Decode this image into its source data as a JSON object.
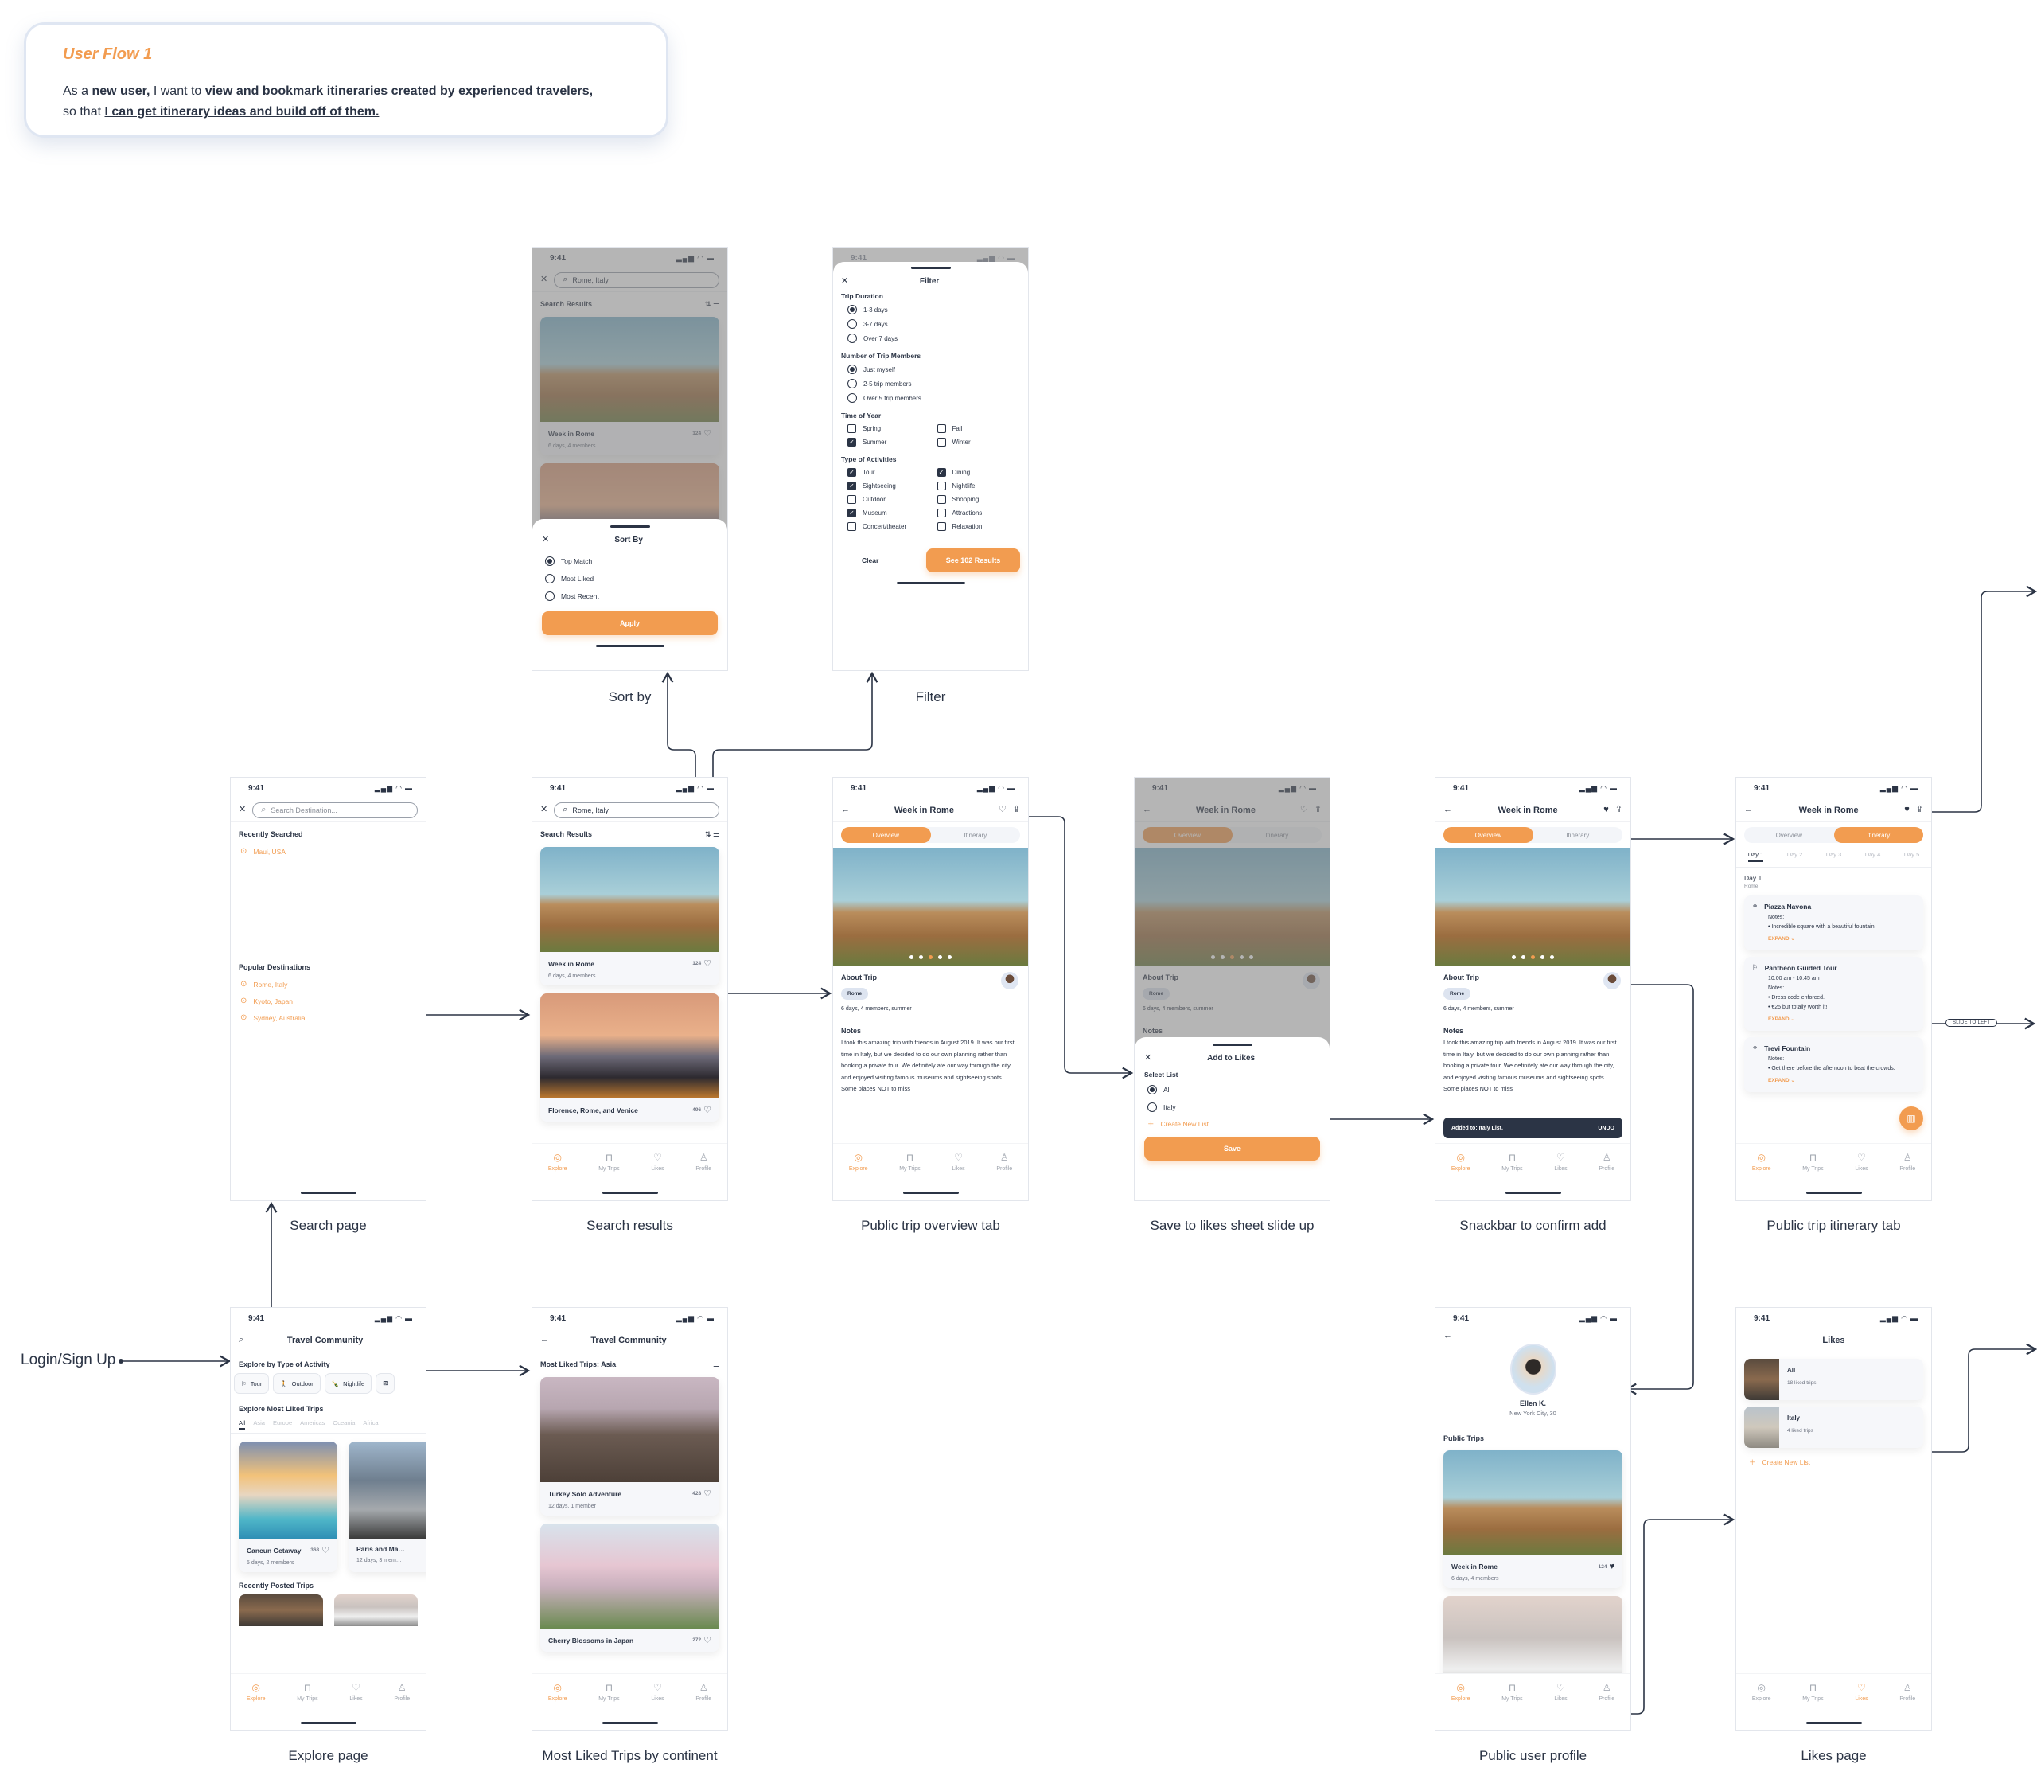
{
  "story": {
    "title": "User Flow 1",
    "prefix": "As a",
    "role": "new user,",
    "mid": "I want to",
    "goal": "view and bookmark itineraries created by experienced travelers,",
    "so": "so that",
    "benefit": "I can get itinerary ideas and build off of them."
  },
  "status_time": "9:41",
  "status_icons": "▂▄▆ ◠ ▬",
  "tabbar": [
    {
      "label": "Explore",
      "icon": "compass-icon",
      "glyph": "◎"
    },
    {
      "label": "My Trips",
      "icon": "bag-icon",
      "glyph": "⊓"
    },
    {
      "label": "Likes",
      "icon": "heart-icon",
      "glyph": "♡"
    },
    {
      "label": "Profile",
      "icon": "user-icon",
      "glyph": "♙"
    }
  ],
  "sort": {
    "caption": "Sort by",
    "search_value": "Rome, Italy",
    "results_title": "Search Results",
    "card_title": "Week in Rome",
    "card_likes": "124",
    "card_sub": "6 days, 4 members",
    "sheet_title": "Sort By",
    "options": [
      {
        "label": "Top Match",
        "selected": true
      },
      {
        "label": "Most Liked",
        "selected": false
      },
      {
        "label": "Most Recent",
        "selected": false
      }
    ],
    "apply": "Apply"
  },
  "filter": {
    "caption": "Filter",
    "title": "Filter",
    "duration_title": "Trip Duration",
    "duration": [
      {
        "label": "1-3 days",
        "selected": true
      },
      {
        "label": "3-7 days",
        "selected": false
      },
      {
        "label": "Over 7 days",
        "selected": false
      }
    ],
    "members_title": "Number of Trip Members",
    "members": [
      {
        "label": "Just myself",
        "selected": true
      },
      {
        "label": "2-5  trip members",
        "selected": false
      },
      {
        "label": "Over 5 trip members",
        "selected": false
      }
    ],
    "season_title": "Time of Year",
    "seasons": [
      {
        "label": "Spring",
        "checked": false
      },
      {
        "label": "Fall",
        "checked": false
      },
      {
        "label": "Summer",
        "checked": true
      },
      {
        "label": "Winter",
        "checked": false
      }
    ],
    "activities_title": "Type of Activities",
    "activities": [
      {
        "label": "Tour",
        "checked": true
      },
      {
        "label": "Dining",
        "checked": true
      },
      {
        "label": "Sightseeing",
        "checked": true
      },
      {
        "label": "Nightlife",
        "checked": false
      },
      {
        "label": "Outdoor",
        "checked": false
      },
      {
        "label": "Shopping",
        "checked": false
      },
      {
        "label": "Museum",
        "checked": true
      },
      {
        "label": "Attractions",
        "checked": false
      },
      {
        "label": "Concert/theater",
        "checked": false
      },
      {
        "label": "Relaxation",
        "checked": false
      }
    ],
    "clear": "Clear",
    "see_results": "See 102 Results"
  },
  "search_page": {
    "caption": "Search page",
    "placeholder": "Search Destination...",
    "recent_title": "Recently Searched",
    "recent": [
      "Maui, USA"
    ],
    "popular_title": "Popular Destinations",
    "popular": [
      "Rome, Italy",
      "Kyoto, Japan",
      "Sydney, Australia"
    ]
  },
  "search_results": {
    "caption": "Search results",
    "search_value": "Rome, Italy",
    "title": "Search Results",
    "cards": [
      {
        "title": "Week in Rome",
        "likes": "124",
        "sub": "6 days, 4 members"
      },
      {
        "title": "Florence, Rome, and Venice",
        "likes": "496",
        "sub": ""
      }
    ]
  },
  "trip": {
    "title": "Week in Rome",
    "tab_overview": "Overview",
    "tab_itinerary": "Itinerary",
    "about_title": "About Trip",
    "chip": "Rome",
    "summary": "6 days, 4 members, summer",
    "notes_title": "Notes",
    "notes": "I took this amazing trip with friends in August 2019. It was our first time in Italy, but we decided to do our own planning rather than booking a private tour. We definitely ate our way through the city, and enjoyed visiting famous museums and sightseeing spots. Some places NOT to miss",
    "carousel_active": 3,
    "carousel_count": 5
  },
  "overview_caption": "Public trip overview tab",
  "save_sheet": {
    "caption": "Save to likes sheet slide up",
    "title": "Add to Likes",
    "select_label": "Select List",
    "lists": [
      {
        "label": "All",
        "selected": true
      },
      {
        "label": "Italy",
        "selected": false
      }
    ],
    "create": "Create New List",
    "save": "Save"
  },
  "snackbar": {
    "caption": "Snackbar to confirm add",
    "message": "Added to: Italy List.",
    "action": "UNDO"
  },
  "itinerary": {
    "caption": "Public trip itinerary tab",
    "days": [
      "Day 1",
      "Day 2",
      "Day 3",
      "Day 4",
      "Day 5"
    ],
    "day_title": "Day 1",
    "day_city": "Rome",
    "items": [
      {
        "name": "Piazza Navona",
        "icon": "binoculars-icon",
        "glyph": "⚭",
        "time": "",
        "notes_label": "Notes:",
        "notes": [
          "Incredible square with a beautiful fountain!"
        ],
        "expand": "EXPAND ⌄"
      },
      {
        "name": "Pantheon Guided Tour",
        "icon": "flag-icon",
        "glyph": "⚐",
        "time": "10:00 am - 10:45 am",
        "notes_label": "Notes:",
        "notes": [
          "Dress code enforced.",
          "€25 but totally worth it!"
        ],
        "expand": "EXPAND ⌄"
      },
      {
        "name": "Trevi Fountain",
        "icon": "binoculars-icon",
        "glyph": "⚭",
        "time": "",
        "notes_label": "Notes:",
        "notes": [
          "Get there before the afternoon to beat the crowds."
        ],
        "expand": "EXPAND ⌄"
      }
    ],
    "slide_label": "SLIDE TO LEFT"
  },
  "explore": {
    "caption": "Explore page",
    "title": "Travel Community",
    "activity_title": "Explore by Type of Activity",
    "activities": [
      {
        "label": "Tour",
        "glyph": "⚐",
        "icon": "flag-icon"
      },
      {
        "label": "Outdoor",
        "glyph": "🚶",
        "icon": "hiker-icon"
      },
      {
        "label": "Nightlife",
        "glyph": "🍾",
        "icon": "bottle-icon"
      },
      {
        "label": "",
        "glyph": "⛾",
        "icon": "dining-icon"
      }
    ],
    "liked_title": "Explore Most Liked Trips",
    "continents": [
      "All",
      "Asia",
      "Europe",
      "Americas",
      "Oceania",
      "Africa"
    ],
    "cards": [
      {
        "title": "Cancun Getaway",
        "likes": "368",
        "sub": "5 days, 2 members"
      },
      {
        "title": "Paris and Ma…",
        "likes": "",
        "sub": "12 days, 3 mem…"
      }
    ],
    "recent_title": "Recently Posted Trips"
  },
  "login_label": "Login/Sign Up",
  "most_liked": {
    "caption": "Most Liked Trips by continent",
    "title": "Travel Community",
    "heading": "Most Liked Trips: Asia",
    "cards": [
      {
        "title": "Turkey Solo Adventure",
        "likes": "428",
        "sub": "12 days, 1 member"
      },
      {
        "title": "Cherry Blossoms in Japan",
        "likes": "272",
        "sub": ""
      }
    ]
  },
  "profile": {
    "caption": "Public user profile",
    "name": "Ellen K.",
    "location": "New York City, 30",
    "trips_title": "Public Trips",
    "cards": [
      {
        "title": "Week in Rome",
        "likes": "124",
        "sub": "6 days, 4 members"
      }
    ]
  },
  "likes_page": {
    "caption": "Likes page",
    "title": "Likes",
    "lists": [
      {
        "name": "All",
        "count": "18 liked trips"
      },
      {
        "name": "Italy",
        "count": "4 liked trips"
      }
    ],
    "create": "Create New List"
  },
  "colors": {
    "accent": "#f29c50",
    "ink": "#2b3445",
    "muted": "#9aa0aa",
    "chip": "#dde4f0"
  }
}
